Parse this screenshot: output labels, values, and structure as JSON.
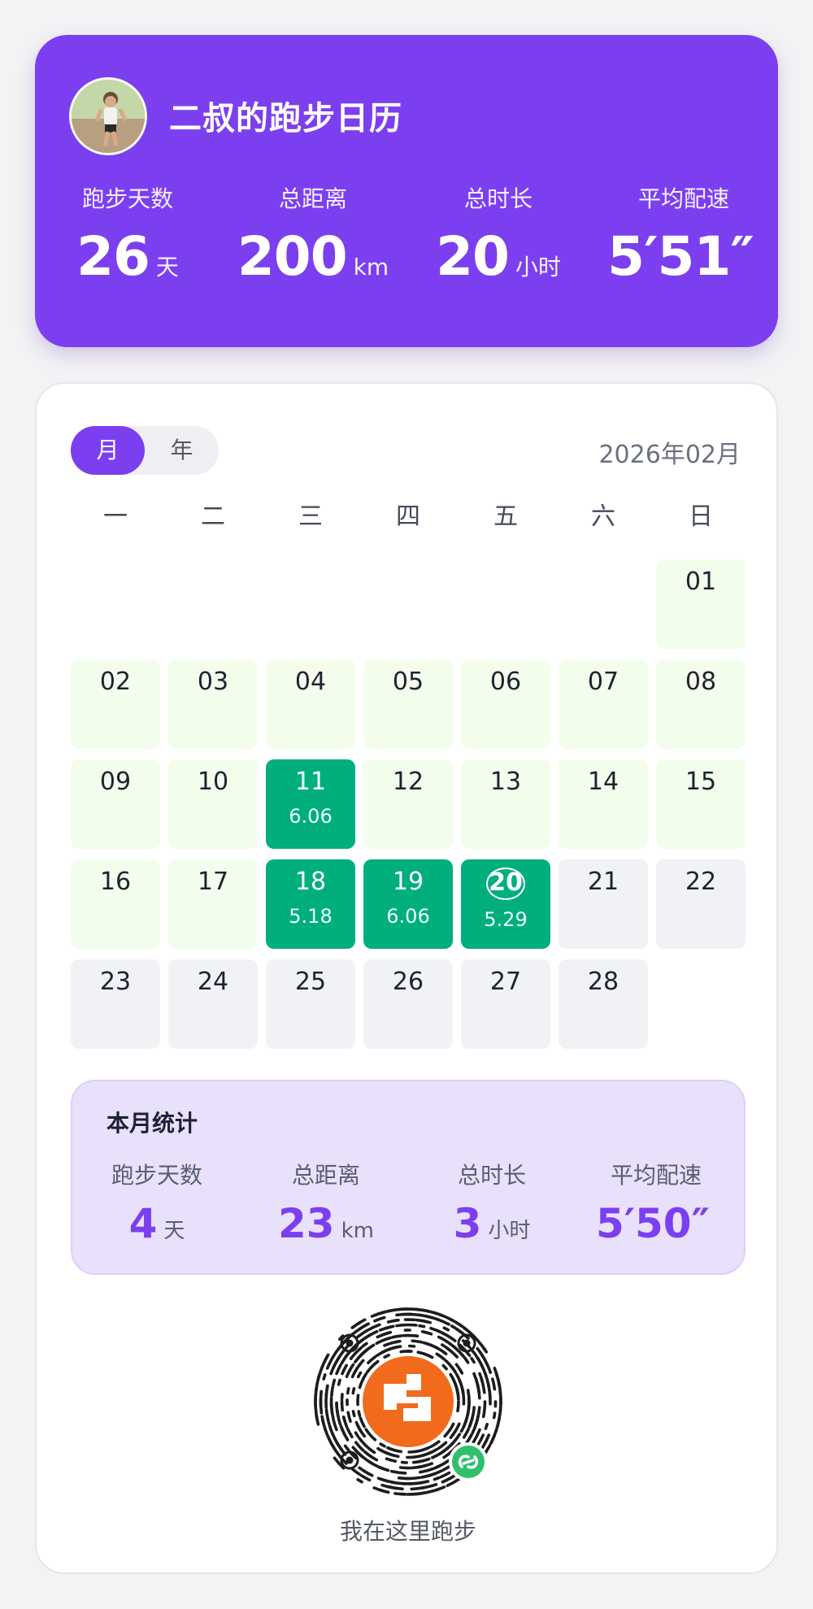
{
  "header": {
    "title": "二叔的跑步日历",
    "stats": [
      {
        "label": "跑步天数",
        "value": "26",
        "unit": "天"
      },
      {
        "label": "总距离",
        "value": "200",
        "unit": "km"
      },
      {
        "label": "总时长",
        "value": "20",
        "unit": "小时"
      },
      {
        "label": "平均配速",
        "value": "5′51″",
        "unit": ""
      }
    ]
  },
  "calendar": {
    "toggle": {
      "month": "月",
      "year": "年",
      "active": "month"
    },
    "month_label": "2026年02月",
    "weekdays": [
      "一",
      "二",
      "三",
      "四",
      "五",
      "六",
      "日"
    ],
    "days": [
      {
        "day": "01",
        "km": "",
        "state": "green"
      },
      {
        "day": "02",
        "km": "",
        "state": "green"
      },
      {
        "day": "03",
        "km": "",
        "state": "green"
      },
      {
        "day": "04",
        "km": "",
        "state": "green"
      },
      {
        "day": "05",
        "km": "",
        "state": "green"
      },
      {
        "day": "06",
        "km": "",
        "state": "green"
      },
      {
        "day": "07",
        "km": "",
        "state": "green"
      },
      {
        "day": "08",
        "km": "",
        "state": "green"
      },
      {
        "day": "09",
        "km": "",
        "state": "green"
      },
      {
        "day": "10",
        "km": "",
        "state": "green"
      },
      {
        "day": "11",
        "km": "6.06",
        "state": "run"
      },
      {
        "day": "12",
        "km": "",
        "state": "green"
      },
      {
        "day": "13",
        "km": "",
        "state": "green"
      },
      {
        "day": "14",
        "km": "",
        "state": "green"
      },
      {
        "day": "15",
        "km": "",
        "state": "green"
      },
      {
        "day": "16",
        "km": "",
        "state": "green"
      },
      {
        "day": "17",
        "km": "",
        "state": "green"
      },
      {
        "day": "18",
        "km": "5.18",
        "state": "run"
      },
      {
        "day": "19",
        "km": "6.06",
        "state": "run"
      },
      {
        "day": "20",
        "km": "5.29",
        "state": "today"
      },
      {
        "day": "21",
        "km": "",
        "state": "gray"
      },
      {
        "day": "22",
        "km": "",
        "state": "gray"
      },
      {
        "day": "23",
        "km": "",
        "state": "gray"
      },
      {
        "day": "24",
        "km": "",
        "state": "gray"
      },
      {
        "day": "25",
        "km": "",
        "state": "gray"
      },
      {
        "day": "26",
        "km": "",
        "state": "gray"
      },
      {
        "day": "27",
        "km": "",
        "state": "gray"
      },
      {
        "day": "28",
        "km": "",
        "state": "gray"
      }
    ],
    "colors": {
      "run": "#00ae7e",
      "past": "#f3fdec",
      "future": "#f1f2f5",
      "accent": "#7b3ff0"
    }
  },
  "month_stats": {
    "title": "本月统计",
    "stats": [
      {
        "label": "跑步天数",
        "value": "4",
        "unit": "天"
      },
      {
        "label": "总距离",
        "value": "23",
        "unit": "km"
      },
      {
        "label": "总时长",
        "value": "3",
        "unit": "小时"
      },
      {
        "label": "平均配速",
        "value": "5′50″",
        "unit": ""
      }
    ]
  },
  "footer": {
    "qr_icon": "mini-program-qr-code-icon",
    "caption": "我在这里跑步"
  }
}
